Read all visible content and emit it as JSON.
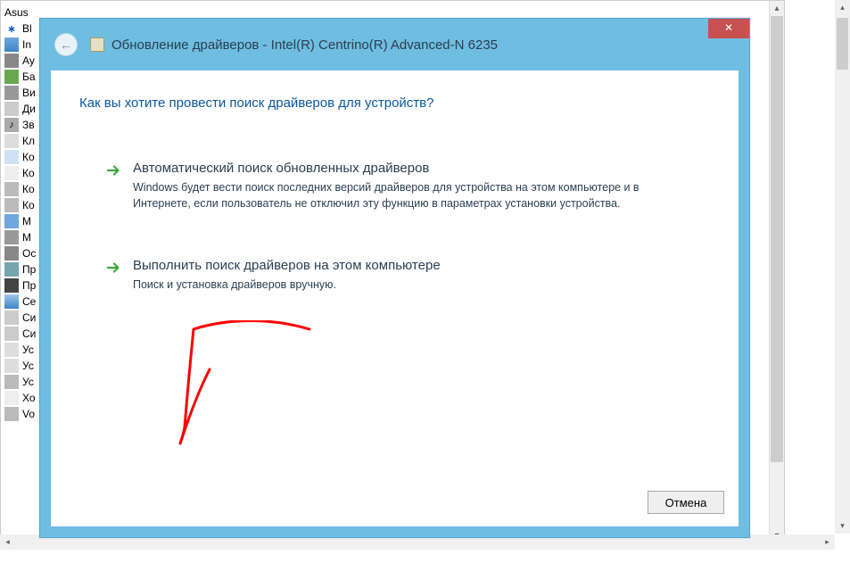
{
  "tree": {
    "root": "Asus",
    "items": [
      {
        "label": "Bl",
        "ico": "ico-bt",
        "glyph": "∗"
      },
      {
        "label": "In",
        "ico": "ico-net",
        "glyph": ""
      },
      {
        "label": "Ау",
        "ico": "ico-audio",
        "glyph": ""
      },
      {
        "label": "Ба",
        "ico": "ico-batt",
        "glyph": ""
      },
      {
        "label": "Ви",
        "ico": "ico-cam",
        "glyph": ""
      },
      {
        "label": "Ди",
        "ico": "ico-disk",
        "glyph": ""
      },
      {
        "label": "Зв",
        "ico": "ico-sound",
        "glyph": "♪"
      },
      {
        "label": "Кл",
        "ico": "ico-kb",
        "glyph": ""
      },
      {
        "label": "Ко",
        "ico": "ico-pc",
        "glyph": ""
      },
      {
        "label": "Ко",
        "ico": "ico-ctrl",
        "glyph": ""
      },
      {
        "label": "Ко",
        "ico": "ico-hid",
        "glyph": ""
      },
      {
        "label": "Ко",
        "ico": "ico-hid",
        "glyph": ""
      },
      {
        "label": "М",
        "ico": "ico-mon",
        "glyph": ""
      },
      {
        "label": "М",
        "ico": "ico-mouse",
        "glyph": ""
      },
      {
        "label": "Ос",
        "ico": "ico-print",
        "glyph": ""
      },
      {
        "label": "Пр",
        "ico": "ico-img",
        "glyph": ""
      },
      {
        "label": "Пр",
        "ico": "ico-cpu",
        "glyph": ""
      },
      {
        "label": "Се",
        "ico": "ico-wifi",
        "glyph": ""
      },
      {
        "label": "Си",
        "ico": "ico-sys",
        "glyph": ""
      },
      {
        "label": "Си",
        "ico": "ico-sys",
        "glyph": ""
      },
      {
        "label": "Ус",
        "ico": "ico-usb",
        "glyph": ""
      },
      {
        "label": "Ус",
        "ico": "ico-usb",
        "glyph": ""
      },
      {
        "label": "Ус",
        "ico": "ico-hid",
        "glyph": ""
      },
      {
        "label": "Хо",
        "ico": "ico-ctrl",
        "glyph": ""
      },
      {
        "label": "Vo",
        "ico": "ico-hid",
        "glyph": ""
      }
    ]
  },
  "dialog": {
    "title": "Обновление драйверов - Intel(R) Centrino(R) Advanced-N 6235",
    "close_label": "✕",
    "question": "Как вы хотите провести поиск драйверов для устройств?",
    "options": [
      {
        "title": "Автоматический поиск обновленных драйверов",
        "desc": "Windows будет вести поиск последних версий драйверов для устройства на этом компьютере и в Интернете, если пользователь не отключил эту функцию в параметрах установки устройства."
      },
      {
        "title": "Выполнить поиск драйверов на этом компьютере",
        "desc": "Поиск и установка драйверов вручную."
      }
    ],
    "cancel_label": "Отмена"
  }
}
